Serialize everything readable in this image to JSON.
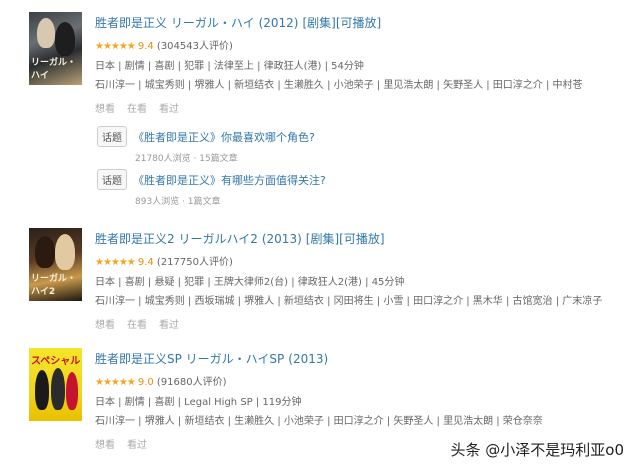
{
  "entries": [
    {
      "poster_text": "リーガル・ハイ",
      "title": "胜者即是正义 リーガル・ハイ",
      "year": "(2012)",
      "tags": [
        "[剧集]",
        "[可播放]"
      ],
      "stars": "★★★★★",
      "score": "9.4",
      "votes": "(304543人评价)",
      "info": "日本 | 剧情 | 喜剧 | 犯罪 | 法律至上 | 律政狂人(港) | 54分钟",
      "cast": "石川淳一 | 城宝秀则 | 堺雅人 | 新垣结衣 | 生濑胜久 | 小池荣子 | 里见浩太朗 | 矢野圣人 | 田口淳之介 | 中村苍",
      "actions": [
        "想看",
        "在看",
        "看过"
      ]
    },
    {
      "poster_text": "リーガル・ハイ2",
      "title": "胜者即是正义2 リーガルハイ2",
      "year": "(2013)",
      "tags": [
        "[剧集]",
        "[可播放]"
      ],
      "stars": "★★★★★",
      "score": "9.4",
      "votes": "(217750人评价)",
      "info": "日本 | 喜剧 | 悬疑 | 犯罪 | 王牌大律师2(台) | 律政狂人2(港) | 45分钟",
      "cast": "石川淳一 | 城宝秀则 | 西坂瑞城 | 堺雅人 | 新垣结衣 | 冈田将生 | 小雪 | 田口淳之介 | 黑木华 | 古馆宽治 | 广末凉子",
      "actions": [
        "想看",
        "在看",
        "看过"
      ]
    },
    {
      "poster_text": "スペシャル",
      "title": "胜者即是正义SP リーガル・ハイSP",
      "year": "(2013)",
      "tags": [],
      "stars": "★★★★★",
      "score": "9.0",
      "votes": "(91680人评价)",
      "info": "日本 | 剧情 | 喜剧 | Legal High SP | 119分钟",
      "cast": "石川淳一 | 堺雅人 | 新垣结衣 | 生濑胜久 | 小池荣子 | 田口淳之介 | 矢野圣人 | 里见浩太朗 | 荣仓奈奈",
      "actions": [
        "想看",
        "看过"
      ]
    }
  ],
  "topics": [
    {
      "badge": "话题",
      "text": "《胜者即是正义》你最喜欢哪个角色?",
      "stat": "21780人浏览 · 15篇文章"
    },
    {
      "badge": "话题",
      "text": "《胜者即是正义》有哪些方面值得关注?",
      "stat": "893人浏览 · 1篇文章"
    }
  ],
  "watermark": "头条 @小泽不是玛利亚o0",
  "colors": {
    "link": "#3377aa",
    "star": "#f6a623",
    "meta": "#666666"
  }
}
